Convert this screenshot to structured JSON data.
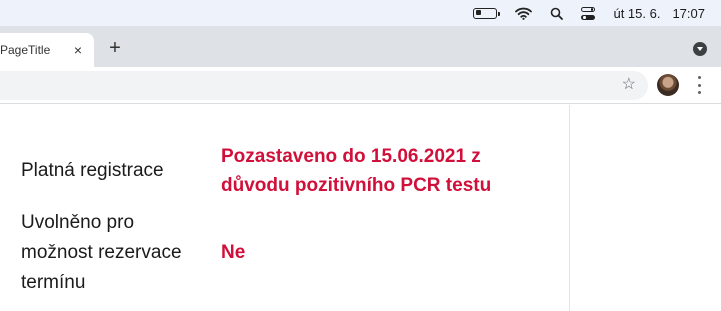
{
  "menubar": {
    "datetime_day": "út 15. 6.",
    "datetime_time": "17:07",
    "icons": [
      "battery-icon",
      "wifi-icon",
      "search-icon",
      "control-center-icon"
    ]
  },
  "browser": {
    "tab_title": "PageTitle",
    "tab_close": "×",
    "new_tab": "+",
    "star": "☆"
  },
  "registration": {
    "row1": {
      "label": "Platná registrace",
      "value_line1": "Pozastaveno do 15.06.2021 z",
      "value_line2": "důvodu pozitivního PCR testu"
    },
    "row2": {
      "label_line1": "Uvolněno pro",
      "label_line2": "možnost rezervace",
      "label_line3": "termínu",
      "value": "Ne"
    }
  },
  "colors": {
    "accent": "#d0103a",
    "tabstrip": "#dee1e6",
    "menubar": "#eef2fb"
  }
}
